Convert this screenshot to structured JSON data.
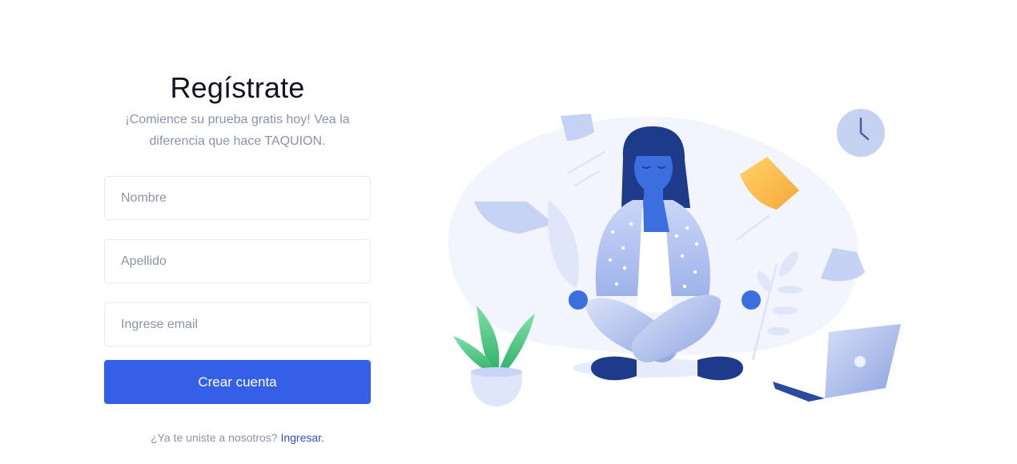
{
  "signup": {
    "title": "Regístrate",
    "subtitle": "¡Comience su prueba gratis hoy! Vea la diferencia que hace TAQUION.",
    "fields": {
      "first_name_placeholder": "Nombre",
      "last_name_placeholder": "Apellido",
      "email_placeholder": "Ingrese email"
    },
    "submit_label": "Crear cuenta",
    "login_prompt": "¿Ya te uniste a nosotros?",
    "login_link": "Ingresar."
  },
  "illustration": {
    "subject": "meditating-woman",
    "icons": [
      "clock-icon",
      "sticky-note-icon",
      "paper-sheet-icon",
      "laptop-icon",
      "potted-plant-icon",
      "leaf-plant-icon"
    ]
  },
  "colors": {
    "accent": "#3460e8",
    "link": "#2d50c6",
    "title": "#13151e",
    "muted": "#8a93ab",
    "border": "#e8ebf2"
  }
}
